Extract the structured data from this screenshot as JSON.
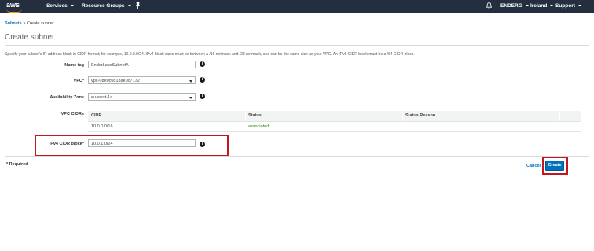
{
  "topbar": {
    "logo_text": "aws",
    "services_label": "Services",
    "resource_groups_label": "Resource Groups",
    "pin_icon": "pin-icon",
    "account_label": "ENDERG",
    "region_label": "Ireland",
    "support_label": "Support"
  },
  "breadcrumb": {
    "link_label": "Subnets",
    "separator": ">",
    "current_label": "Create subnet"
  },
  "page": {
    "title": "Create subnet",
    "description": "Specify your subnet's IP address block in CIDR format; for example, 10.0.0.0/24. IPv4 block sizes must be between a /16 netmask and /28 netmask, and can be the same size as your VPC. An IPv6 CIDR block must be a /64 CIDR block."
  },
  "form": {
    "name_tag": {
      "label": "Name tag",
      "value": "EnderLabsSubnetA"
    },
    "vpc": {
      "label": "VPC*",
      "value": "vpc-08e0c0d13ae0c7172"
    },
    "availability_zone": {
      "label": "Availability Zone",
      "value": "eu-west-1a"
    },
    "vpc_cidrs": {
      "label": "VPC CIDRs",
      "columns": [
        "CIDR",
        "Status",
        "Status Reason"
      ],
      "rows": [
        {
          "cidr": "10.0.0.0/16",
          "status": "associated",
          "status_reason": ""
        }
      ]
    },
    "ipv4_cidr_block": {
      "label": "IPv4 CIDR block*",
      "value": "10.0.1.0/24"
    }
  },
  "footer": {
    "required_note": "* Required",
    "cancel_label": "Cancel",
    "create_label": "Create"
  },
  "colors": {
    "topbar_bg": "#232f3e",
    "accent_orange": "#ff9900",
    "link_blue": "#0073bb",
    "status_green": "#1d8102",
    "highlight_red": "#c4161c"
  }
}
